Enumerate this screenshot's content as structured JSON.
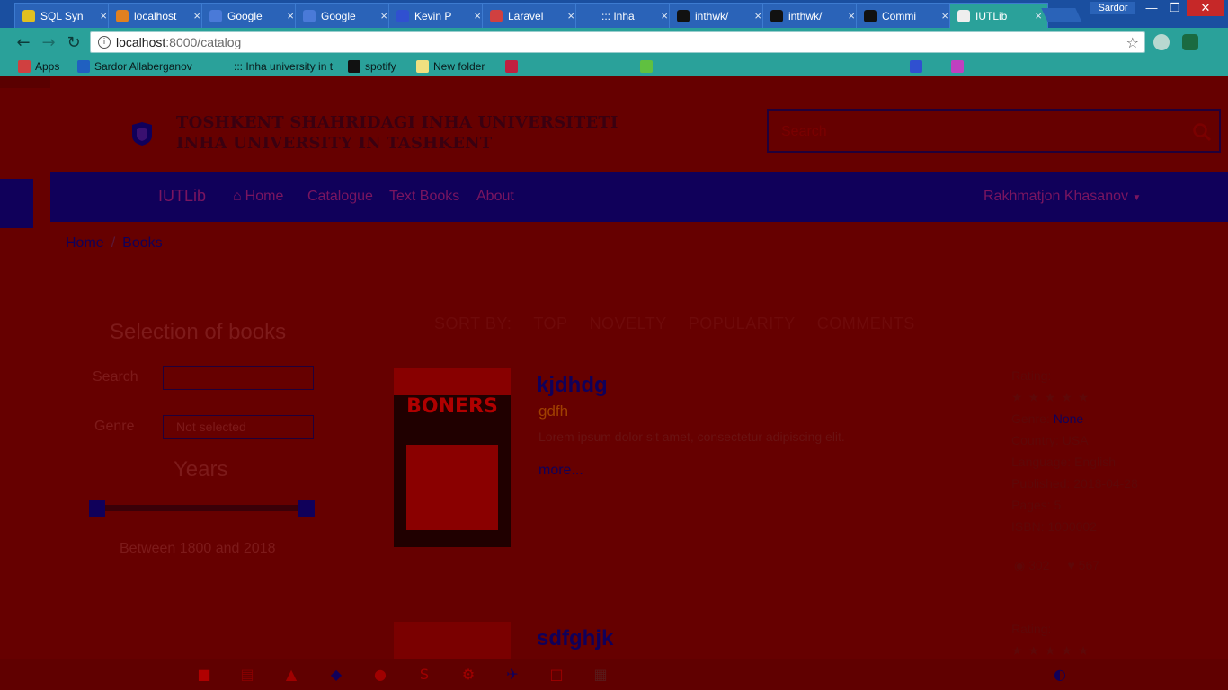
{
  "browser": {
    "tabs": [
      {
        "title": "SQL Syn",
        "color": "#e0c020"
      },
      {
        "title": "localhost",
        "color": "#e08020"
      },
      {
        "title": "Google",
        "color": "#4a7ad8"
      },
      {
        "title": "Google",
        "color": "#4a7ad8"
      },
      {
        "title": "Kevin P",
        "color": "#3050d0"
      },
      {
        "title": "Laravel",
        "color": "#d04040"
      },
      {
        "title": "::: Inha",
        "color": "#2a63b8"
      },
      {
        "title": "inthwk/",
        "color": "#111111"
      },
      {
        "title": "inthwk/",
        "color": "#111111"
      },
      {
        "title": "Commi",
        "color": "#111111"
      },
      {
        "title": "IUTLib",
        "color": "#eeeeee"
      }
    ],
    "user": "Sardor",
    "window_controls": {
      "minimize": "—",
      "maximize": "❐",
      "close": "✕"
    },
    "nav": {
      "back": "←",
      "forward": "→",
      "reload": "↻"
    },
    "address": {
      "host": "localhost",
      "path": ":8000/catalog",
      "info_glyph": "i",
      "star_glyph": "☆"
    },
    "bookmarks": [
      {
        "label": "Apps",
        "icon_color": "#d04040"
      },
      {
        "label": "Sardor Allaberganov",
        "icon_color": "#2060c0"
      },
      {
        "label": "::: Inha university in t",
        "icon_color": "#2aa19a"
      },
      {
        "label": "spotify",
        "icon_color": "#111111"
      },
      {
        "label": "New folder",
        "icon_color": "#f0e080"
      },
      {
        "label": "",
        "icon_color": "#c02040"
      },
      {
        "label": "",
        "icon_color": "#60c040"
      },
      {
        "label": "",
        "icon_color": "#3050d0"
      },
      {
        "label": "",
        "icon_color": "#c040c0"
      }
    ]
  },
  "site": {
    "university_line1": "TOSHKENT SHAHRIDAGI INHA UNIVERSITETI",
    "university_line2": "INHA UNIVERSITY IN TASHKENT",
    "search_placeholder": "Search",
    "brand": "IUTLib",
    "nav": {
      "home": "Home",
      "home_icon": "⌂",
      "catalogue": "Catalogue",
      "textbooks": "Text Books",
      "about": "About"
    },
    "user_menu": "Rakhmatjon Khasanov"
  },
  "breadcrumb": {
    "home": "Home",
    "sep": "/",
    "current": "Books"
  },
  "filters": {
    "title": "Selection of books",
    "search_label": "Search",
    "search_value": "",
    "genre_label": "Genre",
    "genre_value": "Not selected",
    "years_title": "Years",
    "range_text": "Between 1800 and 2018"
  },
  "sort": {
    "label": "SORT BY:",
    "options": [
      "TOP",
      "NOVELTY",
      "POPULARITY",
      "COMMENTS"
    ]
  },
  "books": [
    {
      "title": "kjdhdg",
      "subtitle": "gdfh",
      "description": "Lorem ipsum dolor sit amet, consectetur adipiscing elit.",
      "more": "more...",
      "cover_text": "BONERS",
      "rating_label": "Rating:",
      "rating_stars": "★ ★ ★ ★ ★",
      "genre_label": "Genre:",
      "genre_value": "None",
      "country": "Country: USA",
      "language": "Language: English",
      "published": "Published: 2018-04-28",
      "pages": "Pages: 5",
      "isbn": "ISBN: 1000002",
      "views": "302",
      "likes": "567"
    },
    {
      "title": "sdfghjk",
      "rating_label": "Rating:",
      "rating_stars": "★ ★ ★ ★ ★"
    }
  ],
  "taskbar": [
    "■",
    "▤",
    "▲",
    "◆",
    "●",
    "S",
    "⚙",
    "✈",
    "□",
    "▦",
    "◐"
  ]
}
